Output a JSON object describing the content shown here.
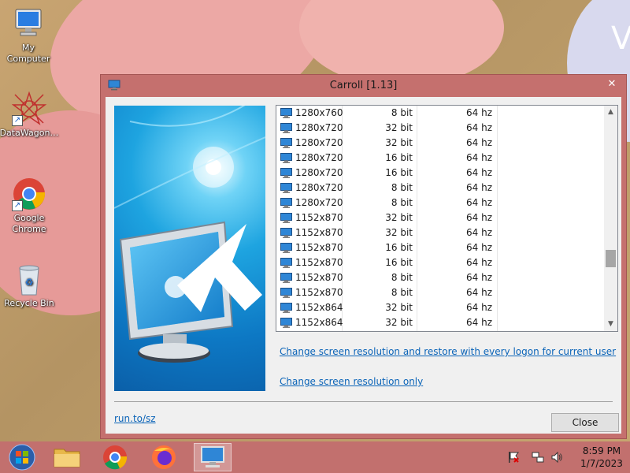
{
  "desktop": {
    "wallpaper_letter": "V",
    "icons": [
      {
        "name": "my-computer",
        "label": "My\nComputer",
        "icon": "computer-icon"
      },
      {
        "name": "datawagon",
        "label": "DataWagon…",
        "icon": "star-logo-icon",
        "shortcut": true
      },
      {
        "name": "google-chrome",
        "label": "Google\nChrome",
        "icon": "chrome-icon",
        "shortcut": true
      },
      {
        "name": "recycle-bin",
        "label": "Recycle Bin",
        "icon": "recycle-bin-icon"
      }
    ]
  },
  "window": {
    "title": "Carroll [1.13]",
    "close_glyph": "✕",
    "resolutions": [
      {
        "res": "1280x760",
        "bits": "8 bit",
        "hz": "64 hz"
      },
      {
        "res": "1280x720",
        "bits": "32 bit",
        "hz": "64 hz"
      },
      {
        "res": "1280x720",
        "bits": "32 bit",
        "hz": "64 hz"
      },
      {
        "res": "1280x720",
        "bits": "16 bit",
        "hz": "64 hz"
      },
      {
        "res": "1280x720",
        "bits": "16 bit",
        "hz": "64 hz"
      },
      {
        "res": "1280x720",
        "bits": "8 bit",
        "hz": "64 hz"
      },
      {
        "res": "1280x720",
        "bits": "8 bit",
        "hz": "64 hz"
      },
      {
        "res": "1152x870",
        "bits": "32 bit",
        "hz": "64 hz"
      },
      {
        "res": "1152x870",
        "bits": "32 bit",
        "hz": "64 hz"
      },
      {
        "res": "1152x870",
        "bits": "16 bit",
        "hz": "64 hz"
      },
      {
        "res": "1152x870",
        "bits": "16 bit",
        "hz": "64 hz"
      },
      {
        "res": "1152x870",
        "bits": "8 bit",
        "hz": "64 hz"
      },
      {
        "res": "1152x870",
        "bits": "8 bit",
        "hz": "64 hz"
      },
      {
        "res": "1152x864",
        "bits": "32 bit",
        "hz": "64 hz"
      },
      {
        "res": "1152x864",
        "bits": "32 bit",
        "hz": "64 hz"
      }
    ],
    "scroll_position": 0.72,
    "link_restore": "Change screen resolution and restore with every logon for current user",
    "link_only": "Change screen resolution only",
    "footer_link": "run.to/sz",
    "close_button": "Close"
  },
  "taskbar": {
    "items": [
      {
        "name": "start",
        "icon": "windows-start-icon"
      },
      {
        "name": "file-explorer",
        "icon": "folder-icon"
      },
      {
        "name": "chrome",
        "icon": "chrome-icon"
      },
      {
        "name": "firefox",
        "icon": "firefox-icon"
      },
      {
        "name": "carroll",
        "icon": "monitor-icon",
        "active": true
      }
    ],
    "tray": [
      "flag-icon",
      "network-icon",
      "speaker-icon"
    ],
    "time": "8:59 PM",
    "date": "1/7/2023"
  },
  "colors": {
    "title_bar": "#c5706e",
    "taskbar": "#c2706e",
    "link": "#0b64b8"
  }
}
